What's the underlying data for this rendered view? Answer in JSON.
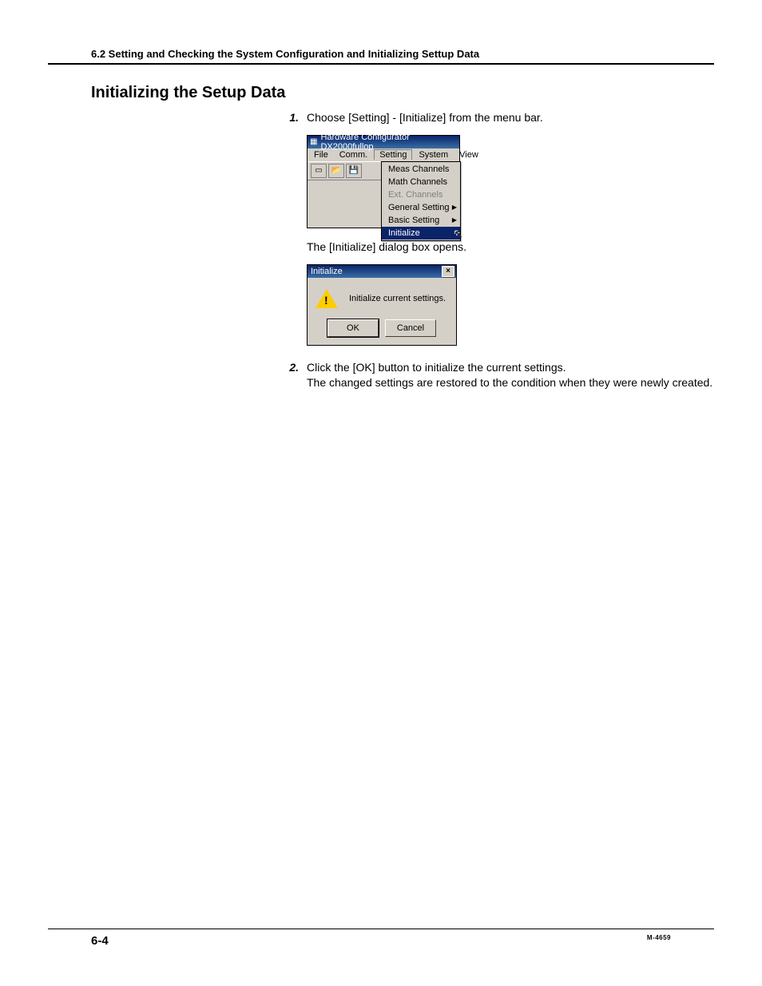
{
  "header": "6.2  Setting and Checking the System Configuration and Initializing Settup Data",
  "section_title": "Initializing the Setup Data",
  "step1_num": "1.",
  "step1_text": "Choose [Setting] - [Initialize] from the menu bar.",
  "app": {
    "title": "Hardware Configurator DX2000fullop",
    "menu": {
      "file": "File",
      "comm": "Comm.",
      "setting": "Setting",
      "system": "System",
      "view": "View"
    },
    "dropdown": {
      "meas": "Meas Channels",
      "math": "Math Channels",
      "ext": "Ext. Channels",
      "general": "General Setting",
      "basic": "Basic Setting",
      "init": "Initialize"
    }
  },
  "after_menu": "The [Initialize] dialog box opens.",
  "dialog": {
    "title": "Initialize",
    "message": "Initialize current settings.",
    "ok": "OK",
    "cancel": "Cancel"
  },
  "step2_num": "2.",
  "step2_line1": "Click the [OK] button to initialize the current settings.",
  "step2_line2": "The changed settings are restored to the condition when they were newly created.",
  "footer": {
    "page": "6-4",
    "doc": "M-4659"
  }
}
